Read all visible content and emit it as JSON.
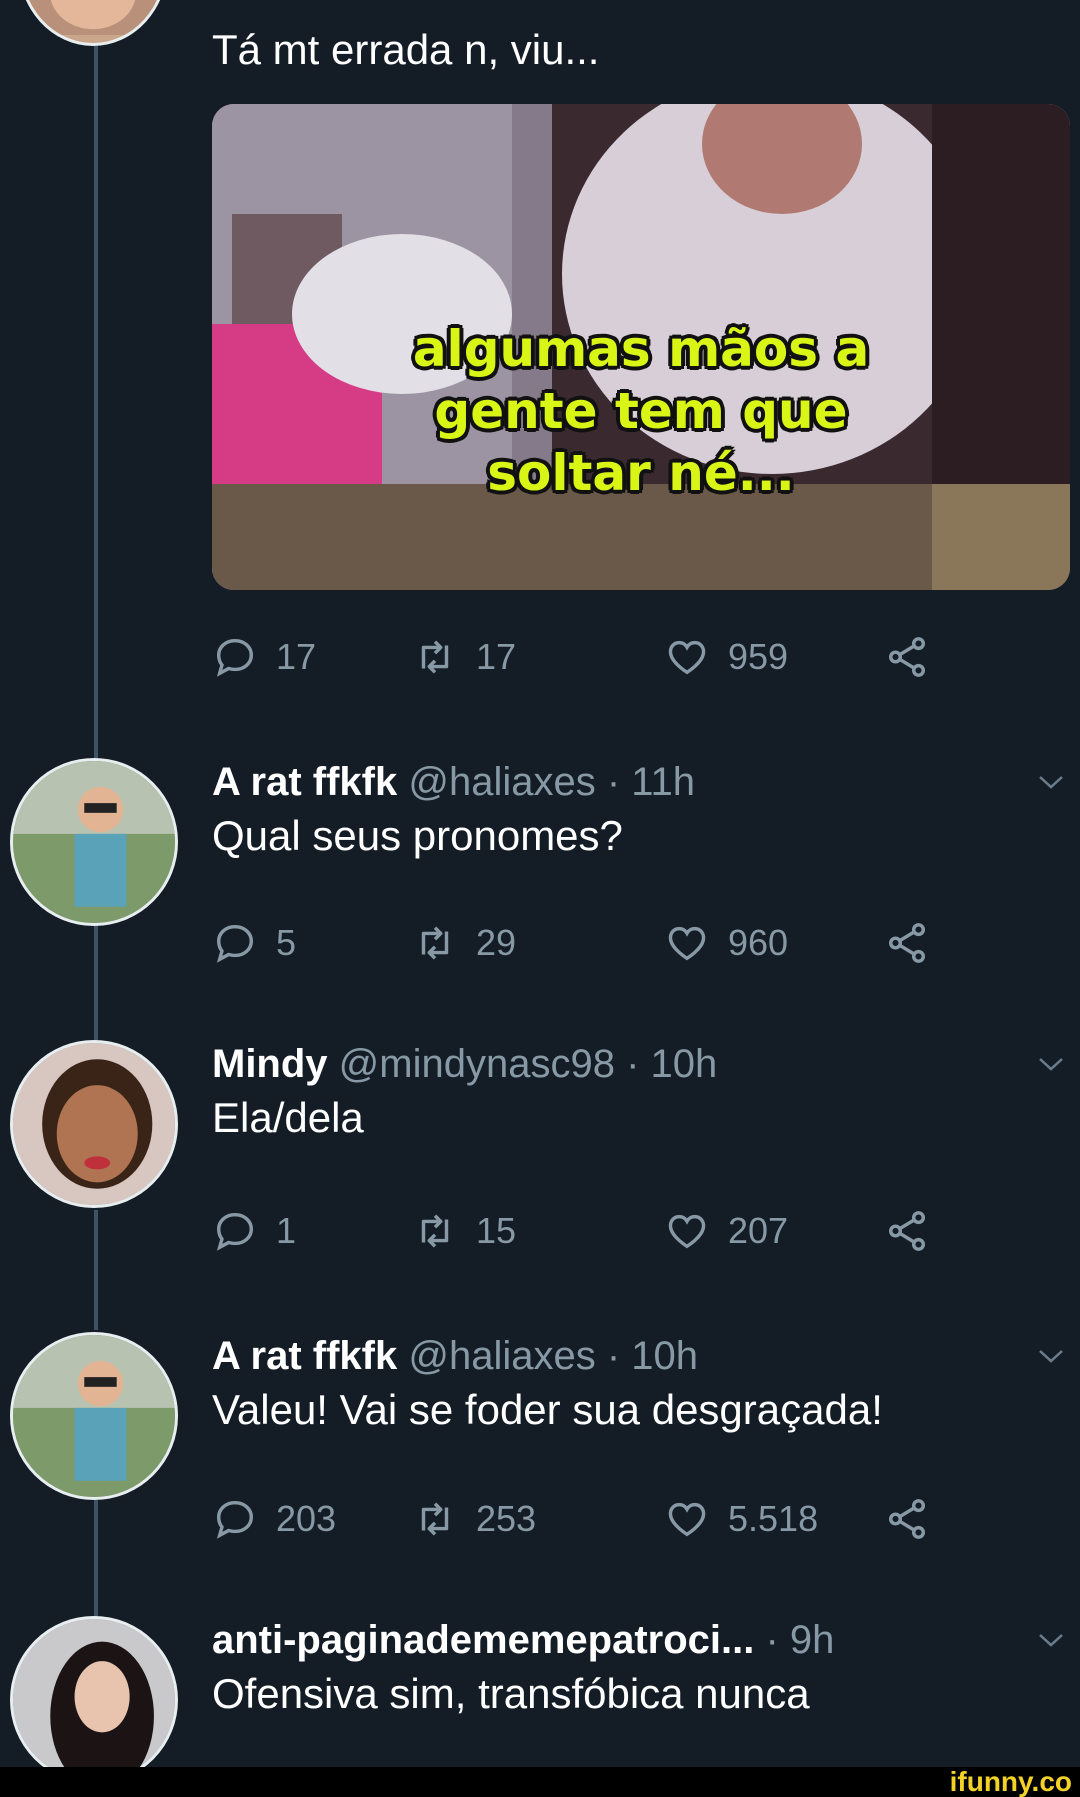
{
  "tweets": [
    {
      "text": "Tá mt errada n, viu...",
      "media_caption": [
        "algumas mãos a",
        "gente tem que",
        "soltar né..."
      ],
      "stats": {
        "replies": "17",
        "retweets": "17",
        "likes": "959"
      }
    },
    {
      "name": "A rat ffkfk",
      "handle": "@haliaxes · 11h",
      "text": "Qual seus pronomes?",
      "stats": {
        "replies": "5",
        "retweets": "29",
        "likes": "960"
      }
    },
    {
      "name": "Mindy",
      "handle": "@mindynasc98 · 10h",
      "text": "Ela/dela",
      "stats": {
        "replies": "1",
        "retweets": "15",
        "likes": "207"
      }
    },
    {
      "name": "A rat ffkfk",
      "handle": "@haliaxes · 10h",
      "text": "Valeu! Vai se foder sua desgraçada!",
      "stats": {
        "replies": "203",
        "retweets": "253",
        "likes": "5.518"
      }
    },
    {
      "name": "anti-paginadememepatroci...",
      "handle": "· 9h",
      "text": "Ofensiva sim, transfóbica nunca"
    }
  ],
  "watermark": "ifunny.co",
  "colors": {
    "background": "#141d26",
    "secondary_text": "#8899a6",
    "thread_line": "#3d5466",
    "caption": "#d9f516"
  }
}
